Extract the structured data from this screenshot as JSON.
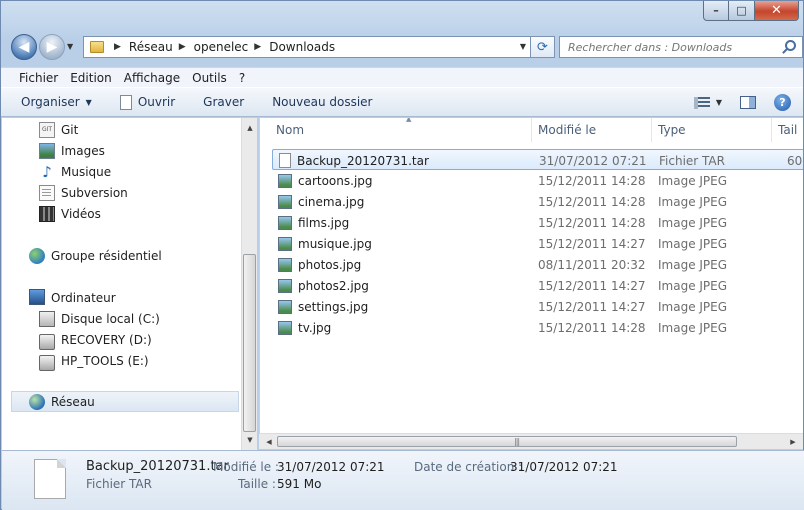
{
  "window": {
    "buttons": {
      "minimize": "–",
      "maximize": "□",
      "close": "✕"
    }
  },
  "address": {
    "crumbs": [
      "Réseau",
      "openelec",
      "Downloads"
    ]
  },
  "search": {
    "placeholder": "Rechercher dans : Downloads"
  },
  "menu": [
    "Fichier",
    "Edition",
    "Affichage",
    "Outils",
    "?"
  ],
  "toolbar": {
    "organize": "Organiser",
    "open": "Ouvrir",
    "burn": "Graver",
    "new_folder": "Nouveau dossier"
  },
  "nav": {
    "items": [
      {
        "label": "Git",
        "icon": "git-folder-icon"
      },
      {
        "label": "Images",
        "icon": "images-icon"
      },
      {
        "label": "Musique",
        "icon": "music-icon"
      },
      {
        "label": "Subversion",
        "icon": "subversion-icon"
      },
      {
        "label": "Vidéos",
        "icon": "videos-icon"
      },
      {
        "label": "Groupe résidentiel",
        "icon": "homegroup-icon"
      },
      {
        "label": "Ordinateur",
        "icon": "computer-icon"
      },
      {
        "label": "Disque local (C:)",
        "icon": "local-disk-icon"
      },
      {
        "label": "RECOVERY (D:)",
        "icon": "drive-icon"
      },
      {
        "label": "HP_TOOLS (E:)",
        "icon": "drive-icon"
      },
      {
        "label": "Réseau",
        "icon": "network-icon"
      }
    ]
  },
  "columns": {
    "name": "Nom",
    "modified": "Modifié le",
    "type": "Type",
    "size": "Tail"
  },
  "files": [
    {
      "name": "Backup_20120731.tar",
      "modified": "31/07/2012 07:21",
      "type": "Fichier TAR",
      "size": "60",
      "kind": "tar"
    },
    {
      "name": "cartoons.jpg",
      "modified": "15/12/2011 14:28",
      "type": "Image JPEG",
      "size": "",
      "kind": "jpg"
    },
    {
      "name": "cinema.jpg",
      "modified": "15/12/2011 14:28",
      "type": "Image JPEG",
      "size": "",
      "kind": "jpg"
    },
    {
      "name": "films.jpg",
      "modified": "15/12/2011 14:28",
      "type": "Image JPEG",
      "size": "",
      "kind": "jpg"
    },
    {
      "name": "musique.jpg",
      "modified": "15/12/2011 14:27",
      "type": "Image JPEG",
      "size": "",
      "kind": "jpg"
    },
    {
      "name": "photos.jpg",
      "modified": "08/11/2011 20:32",
      "type": "Image JPEG",
      "size": "",
      "kind": "jpg"
    },
    {
      "name": "photos2.jpg",
      "modified": "15/12/2011 14:27",
      "type": "Image JPEG",
      "size": "",
      "kind": "jpg"
    },
    {
      "name": "settings.jpg",
      "modified": "15/12/2011 14:27",
      "type": "Image JPEG",
      "size": "",
      "kind": "jpg"
    },
    {
      "name": "tv.jpg",
      "modified": "15/12/2011 14:28",
      "type": "Image JPEG",
      "size": "",
      "kind": "jpg"
    }
  ],
  "details": {
    "name": "Backup_20120731.tar",
    "type": "Fichier TAR",
    "modified_label": "Modifié le :",
    "modified_value": "31/07/2012 07:21",
    "size_label": "Taille :",
    "size_value": "591 Mo",
    "created_label": "Date de création :",
    "created_value": "31/07/2012 07:21"
  }
}
